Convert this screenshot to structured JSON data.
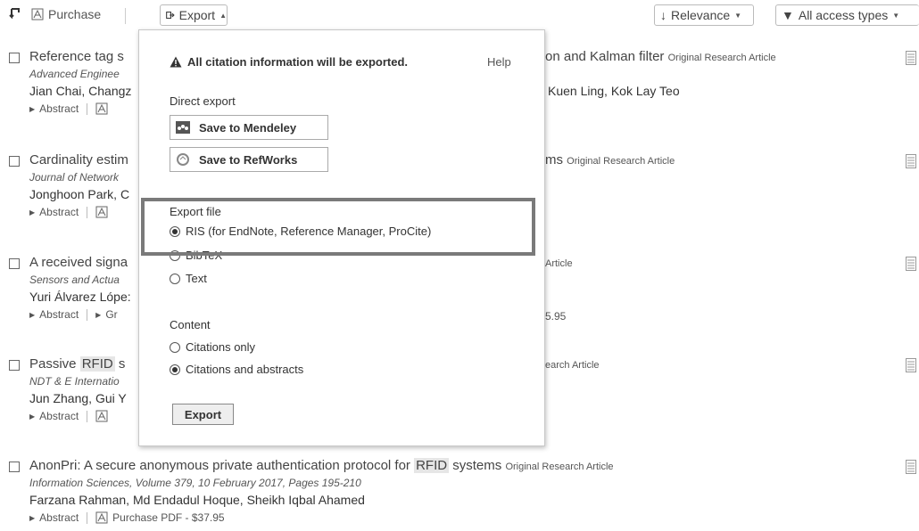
{
  "toolbar": {
    "purchase_label": "Purchase",
    "export_label": "Export",
    "relevance_label": "Relevance",
    "access_label": "All access types"
  },
  "results": [
    {
      "title_start": "Reference tag s",
      "title_end": "on and Kalman filter",
      "article_type": "Original Research Article",
      "source": "Advanced Enginee",
      "authors": "Jian Chai, Changz",
      "authors_end": "Kuen Ling, Kok Lay Teo",
      "abstract": "Abstract"
    },
    {
      "title_start": "Cardinality estim",
      "title_end": "ms",
      "article_type": "Original Research Article",
      "source": "Journal of Network",
      "authors": "Jonghoon Park, C",
      "abstract": "Abstract"
    },
    {
      "title_start": "A received signa",
      "article_type": "Article",
      "source": "Sensors and Actua",
      "authors": "Yuri Álvarez Lópe:",
      "abstract": "Abstract",
      "extra_action": "Gr",
      "price_fragment": "5.95"
    },
    {
      "title_start": "Passive",
      "title_hl": "RFID",
      "title_mid": "s",
      "article_type": "earch Article",
      "source": "NDT & E Internatio",
      "authors": "Jun Zhang, Gui Y",
      "abstract": "Abstract"
    },
    {
      "title_start": "AnonPri: A secure anonymous private authentication protocol for",
      "title_hl": "RFID",
      "title_end": "systems",
      "article_type": "Original Research Article",
      "source": "Information Sciences, Volume 379, 10 February 2017, Pages 195-210",
      "authors": "Farzana Rahman, Md Endadul Hoque, Sheikh Iqbal Ahamed",
      "abstract": "Abstract",
      "purchase_pdf": "Purchase PDF - $37.95"
    }
  ],
  "popup": {
    "warning": "All citation information will be exported.",
    "help": "Help",
    "direct_export": "Direct export",
    "mendeley": "Save to Mendeley",
    "refworks": "Save to RefWorks",
    "export_file": "Export file",
    "formats": [
      {
        "label": "RIS (for EndNote, Reference Manager, ProCite)",
        "selected": true
      },
      {
        "label": "BibTeX",
        "selected": false
      },
      {
        "label": "Text",
        "selected": false
      }
    ],
    "content": "Content",
    "content_options": [
      {
        "label": "Citations only",
        "selected": false
      },
      {
        "label": "Citations and abstracts",
        "selected": true
      }
    ],
    "export_button": "Export"
  }
}
